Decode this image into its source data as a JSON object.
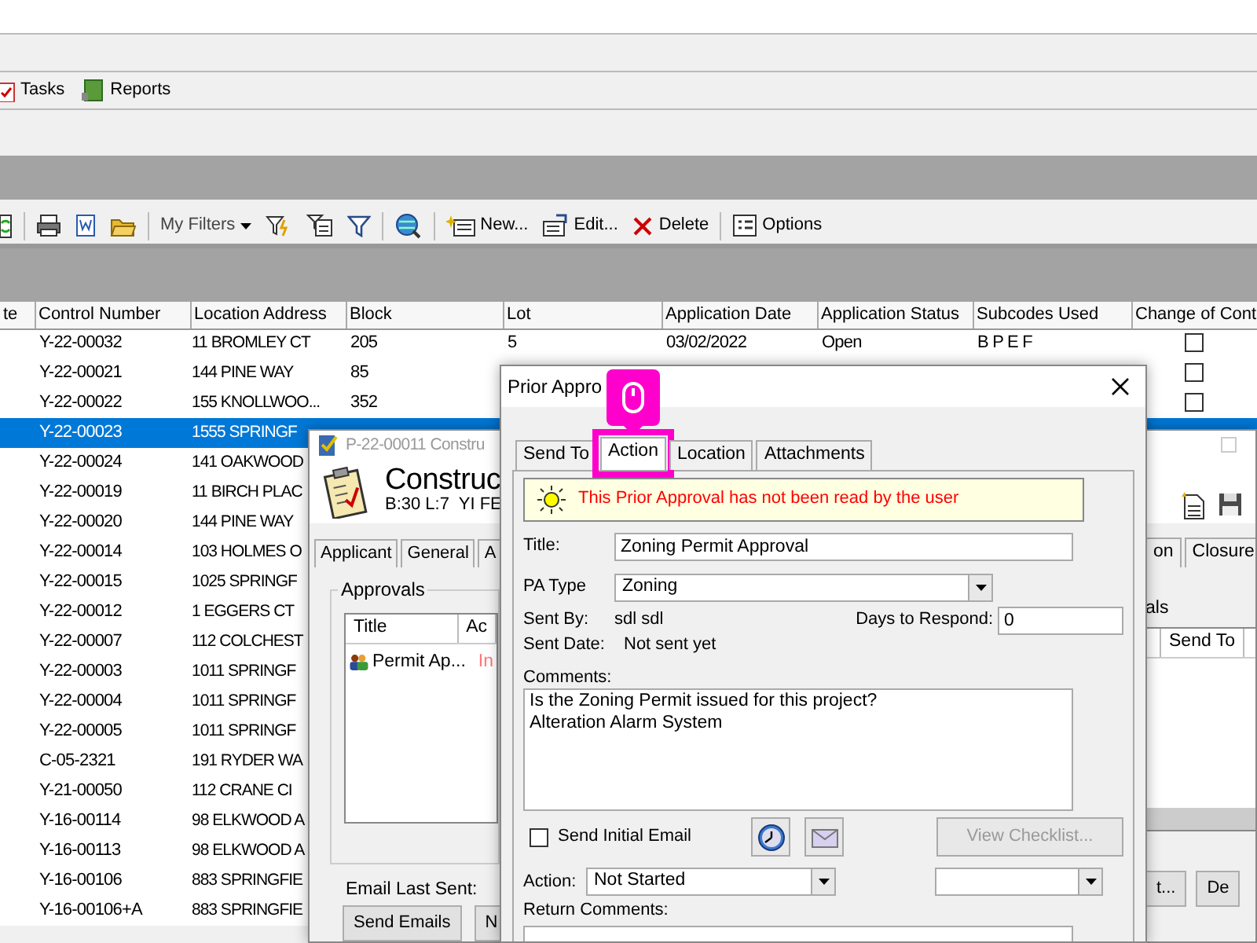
{
  "toolbar_top": {
    "items": [
      {
        "label": "Tasks"
      },
      {
        "label": "Reports"
      }
    ]
  },
  "toolbar": {
    "items": [
      {
        "label": "My Filters"
      },
      {
        "label": "New..."
      },
      {
        "label": "Edit..."
      },
      {
        "label": "Delete"
      },
      {
        "label": "Options"
      }
    ]
  },
  "table": {
    "columns": [
      "te",
      "Control Number",
      "Location Address",
      "Block",
      "Lot",
      "Application Date",
      "Application Status",
      "Subcodes Used",
      "Change of Cont"
    ],
    "rows": [
      {
        "control_number": "Y-22-00032",
        "location_address": "11 BROMLEY CT",
        "block": "205",
        "lot": "5",
        "application_date": "03/02/2022",
        "application_status": "Open",
        "subcodes_used": "B P E F",
        "checked": false,
        "selected": false
      },
      {
        "control_number": "Y-22-00021",
        "location_address": "144 PINE WAY",
        "block": "85",
        "checked": false,
        "selected": false
      },
      {
        "control_number": "Y-22-00022",
        "location_address": "155 KNOLLWOO...",
        "block": "352",
        "checked": false,
        "selected": false
      },
      {
        "control_number": "Y-22-00023",
        "location_address": "1555 SPRINGF",
        "selected": true
      },
      {
        "control_number": "Y-22-00024",
        "location_address": "141 OAKWOOD",
        "selected": false
      },
      {
        "control_number": "Y-22-00019",
        "location_address": "11 BIRCH PLAC",
        "selected": false
      },
      {
        "control_number": "Y-22-00020",
        "location_address": "144 PINE WAY",
        "selected": false
      },
      {
        "control_number": "Y-22-00014",
        "location_address": "103 HOLMES O",
        "selected": false
      },
      {
        "control_number": "Y-22-00015",
        "location_address": "1025 SPRINGF",
        "selected": false
      },
      {
        "control_number": "Y-22-00012",
        "location_address": "1 EGGERS CT",
        "selected": false
      },
      {
        "control_number": "Y-22-00007",
        "location_address": "112 COLCHEST",
        "selected": false
      },
      {
        "control_number": "Y-22-00003",
        "location_address": "1011 SPRINGF",
        "selected": false
      },
      {
        "control_number": "Y-22-00004",
        "location_address": "1011 SPRINGF",
        "selected": false
      },
      {
        "control_number": "Y-22-00005",
        "location_address": "1011 SPRINGF",
        "selected": false
      },
      {
        "control_number": "C-05-2321",
        "location_address": "191 RYDER WA",
        "selected": false
      },
      {
        "control_number": "Y-21-00050",
        "location_address": "112 CRANE CI",
        "selected": false
      },
      {
        "control_number": "Y-16-00114",
        "location_address": "98 ELKWOOD A",
        "selected": false
      },
      {
        "control_number": "Y-16-00113",
        "location_address": "98 ELKWOOD A",
        "selected": false
      },
      {
        "control_number": "Y-16-00106",
        "location_address": "883 SPRINGFIE",
        "selected": false
      },
      {
        "control_number": "Y-16-00106+A",
        "location_address": "883 SPRINGFIE",
        "selected": false
      }
    ]
  },
  "construction_window": {
    "title": "P-22-00011 Constru",
    "heading": "Construc",
    "subheading": "B:30 L:7  YI FE",
    "tabs_left": [
      "Applicant",
      "General",
      "A"
    ],
    "tabs_right": [
      "on",
      "Closure"
    ],
    "approvals": {
      "legend": "Approvals",
      "columns": [
        "Title",
        "Ac"
      ],
      "rows": [
        {
          "title": "Permit Ap...",
          "status": "In"
        }
      ]
    },
    "email_last_sent_label": "Email Last Sent:",
    "buttons_left": [
      "Send Emails",
      "N"
    ],
    "right_panel": {
      "label": "als",
      "columns": [
        "Send To"
      ],
      "buttons": [
        "t...",
        "De"
      ]
    }
  },
  "dialog": {
    "title": "Prior Appro",
    "tabs": [
      {
        "label": "Send To",
        "selected": false,
        "highlighted": false
      },
      {
        "label": "Action",
        "selected": true,
        "highlighted": true
      },
      {
        "label": "Location",
        "selected": false,
        "highlighted": false
      },
      {
        "label": "Attachments",
        "selected": false,
        "highlighted": false
      }
    ],
    "notice": "This Prior Approval has not been read by the user",
    "title_label": "Title:",
    "title_value": "Zoning Permit Approval",
    "pa_type_label": "PA Type",
    "pa_type_value": "Zoning",
    "sent_by_label": "Sent By:",
    "sent_by_value": "sdl sdl",
    "days_label": "Days to Respond:",
    "days_value": "0",
    "sent_date_label": "Sent Date:",
    "sent_date_value": "Not sent yet",
    "comments_label": "Comments:",
    "comments_value": "Is the Zoning Permit issued for this project?\nAlteration Alarm System",
    "send_initial_email": {
      "label": "Send Initial Email",
      "checked": false
    },
    "view_checklist": {
      "label": "View Checklist...",
      "disabled": true
    },
    "action_label": "Action:",
    "action_value": "Not Started",
    "return_comments_label": "Return Comments:"
  }
}
